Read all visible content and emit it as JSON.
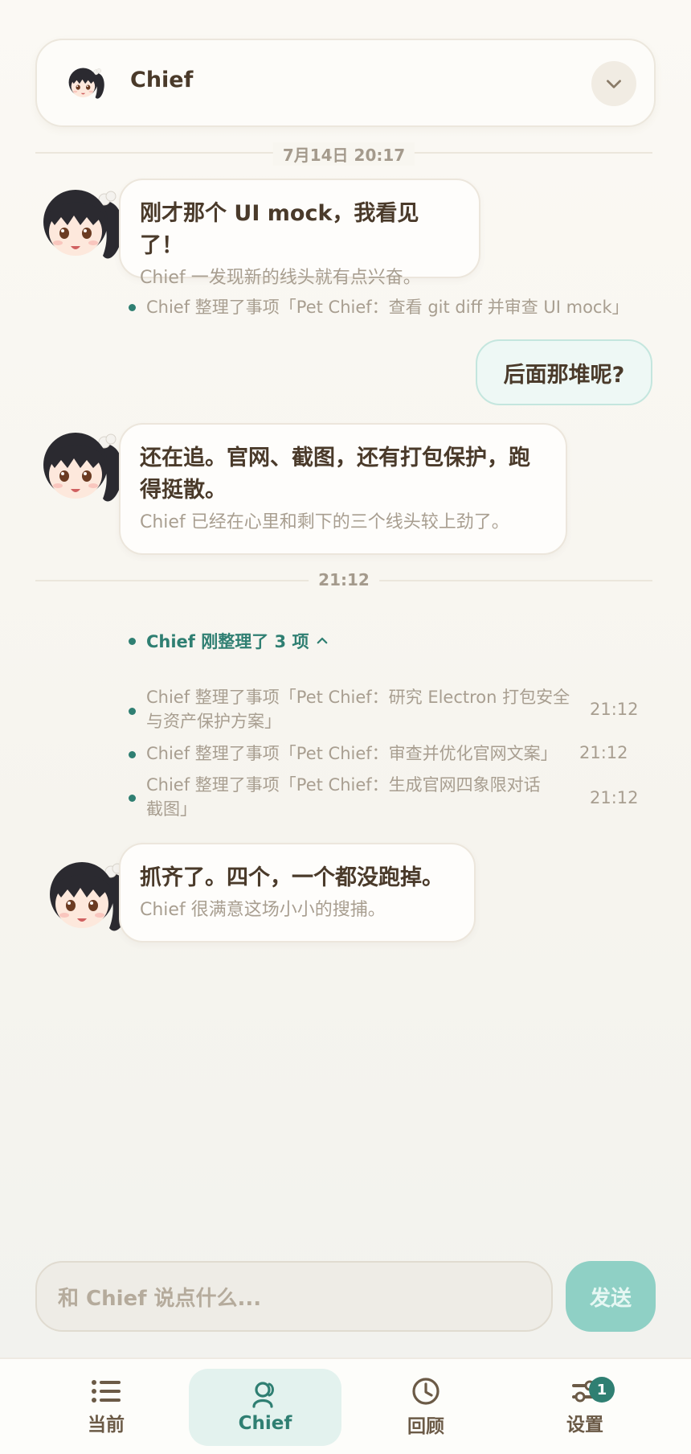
{
  "header": {
    "title": "Chief"
  },
  "timeline": {
    "divider_1": "7月14日 20:17",
    "divider_2": "21:12"
  },
  "messages": [
    {
      "main": "刚才那个 UI mock，我看见了！",
      "sub": "Chief 一发现新的线头就有点兴奋。"
    },
    {
      "main_line1": "还在追。官网、截图，还有打包保护，跑",
      "main_line2": "得挺散。",
      "sub": "Chief 已经在心里和剩下的三个线头较上劲了。"
    },
    {
      "main": "抓齐了。四个，一个都没跑掉。",
      "sub": "Chief 很满意这场小小的搜捕。"
    }
  ],
  "user_message": "后面那堆呢?",
  "event_1": "Chief 整理了事项「Pet Chief：查看 git diff 并审查 UI mock」",
  "group": {
    "label": "Chief 刚整理了 3 项",
    "items": [
      {
        "line1": "Chief 整理了事项「Pet Chief：研究 Electron 打包安全",
        "line2": "与资产保护方案」",
        "time": "21:12"
      },
      {
        "line1": "Chief 整理了事项「Pet Chief：审查并优化官网文案」",
        "line2": "",
        "time": "21:12"
      },
      {
        "line1": "Chief 整理了事项「Pet Chief：生成官网四象限对话",
        "line2": "截图」",
        "time": "21:12"
      }
    ]
  },
  "composer": {
    "placeholder": "和 Chief 说点什么...",
    "send_label": "发送"
  },
  "tabs": [
    {
      "label": "当前",
      "icon": "list-icon"
    },
    {
      "label": "Chief",
      "icon": "person-icon"
    },
    {
      "label": "回顾",
      "icon": "clock-icon"
    },
    {
      "label": "设置",
      "icon": "sliders-icon",
      "badge": "1"
    }
  ],
  "colors": {
    "accent": "#2f7f72",
    "send": "#8fd0c5",
    "text": "#4a3a2a",
    "muted": "#a89e90"
  }
}
